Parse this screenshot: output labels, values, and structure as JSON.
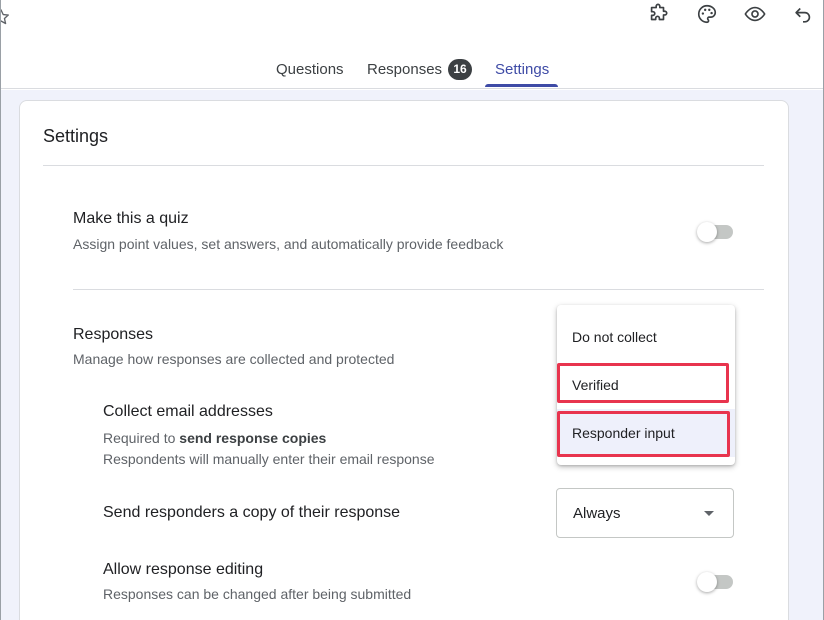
{
  "header": {
    "icons": [
      "star-icon",
      "addon-puzzle-icon",
      "palette-icon",
      "preview-eye-icon",
      "undo-icon"
    ],
    "tabs": [
      {
        "label": "Questions"
      },
      {
        "label": "Responses",
        "badge": "16"
      },
      {
        "label": "Settings",
        "active": true
      }
    ]
  },
  "settings": {
    "title": "Settings",
    "quiz": {
      "title": "Make this a quiz",
      "description": "Assign point values, set answers, and automatically provide feedback",
      "enabled": false
    },
    "responses": {
      "title": "Responses",
      "description": "Manage how responses are collected and protected",
      "collect_email": {
        "title": "Collect email addresses",
        "line1_prefix": "Required to ",
        "line1_bold": "send response copies",
        "line2": "Respondents will manually enter their email response"
      },
      "send_copy": {
        "title": "Send responders a copy of their response",
        "value": "Always"
      },
      "allow_editing": {
        "title": "Allow response editing",
        "description": "Responses can be changed after being submitted",
        "enabled": false
      }
    },
    "email_dropdown": {
      "options": [
        "Do not collect",
        "Verified",
        "Responder input"
      ],
      "selected": "Responder input"
    }
  },
  "colors": {
    "accent": "#3e4ba6",
    "page_bg": "#f0f2fb",
    "highlight": "#e8344e",
    "selected_bg": "#eef0fb"
  }
}
